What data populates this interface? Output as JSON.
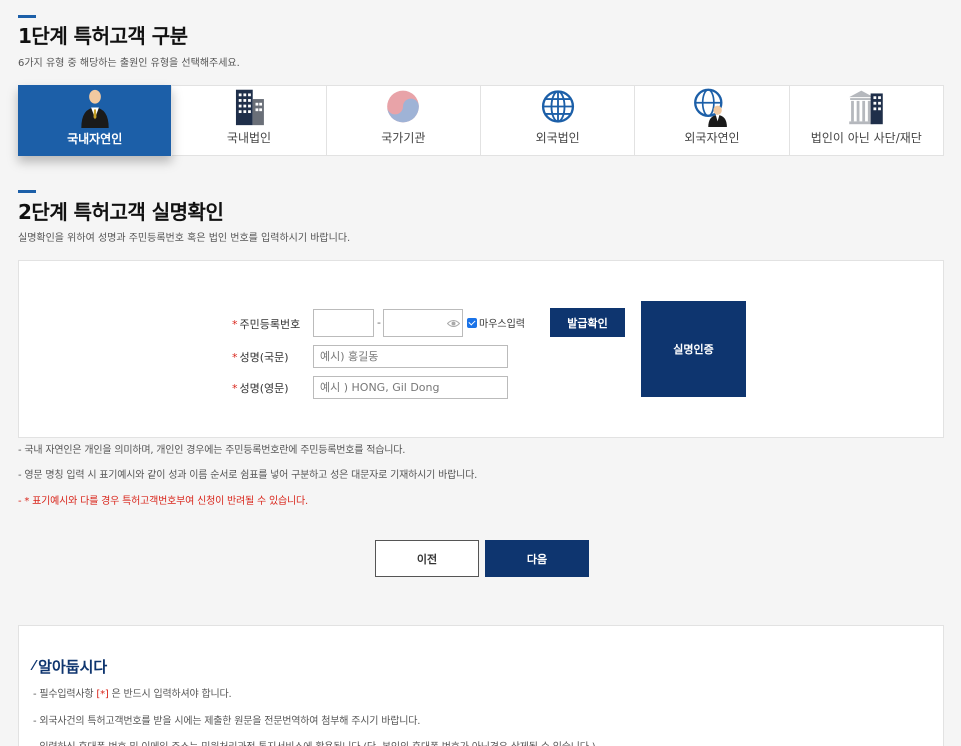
{
  "step1": {
    "title": "1단계 특허고객 구분",
    "desc": "6가지 유형 중 해당하는 출원인 유형을 선택해주세요.",
    "types": [
      {
        "label": "국내자연인",
        "icon": "person-suit-icon",
        "active": true
      },
      {
        "label": "국내법인",
        "icon": "building-icon",
        "active": false
      },
      {
        "label": "국가기관",
        "icon": "taegeuk-icon",
        "active": false
      },
      {
        "label": "외국법인",
        "icon": "globe-icon",
        "active": false
      },
      {
        "label": "외국자연인",
        "icon": "globe-person-icon",
        "active": false
      },
      {
        "label": "법인이 아닌 사단/재단",
        "icon": "institution-icon",
        "active": false
      }
    ]
  },
  "step2": {
    "title": "2단계 특허고객 실명확인",
    "desc": "실명확인을 위하여 성명과 주민등록번호 혹은 법인 번호를 입력하시기 바랍니다.",
    "required_mark": "*",
    "rrn_label": "주민등록번호",
    "rrn_dash": "-",
    "mouse_input_label": "마우스입력",
    "issue_check_label": "발급확인",
    "name_kr_label": "성명(국문)",
    "name_kr_placeholder": "예시) 홍길동",
    "name_en_label": "성명(영문)",
    "name_en_placeholder": "예시 ) HONG, Gil Dong",
    "verify_button": "실명인증"
  },
  "notes": [
    "- 국내 자연인은 개인을 의미하며, 개인인 경우에는 주민등록번호란에 주민등록번호를 적습니다.",
    "- 영문 명칭 입력 시 표기예시와 같이 성과 이름 순서로 쉼표를 넣어 구분하고 성은 대문자로 기재하시기 바랍니다.",
    "- * 표기예시와 다를 경우 특허고객번호부여 신청이 반려될 수 있습니다."
  ],
  "nav": {
    "prev": "이전",
    "next": "다음"
  },
  "notice": {
    "title": "알아둡시다",
    "line1_pre": "- 필수입력사항 ",
    "line1_mark": "[*]",
    "line1_post": " 은 반드시 입력하셔야 합니다.",
    "line2": "- 외국사건의 특허고객번호를 받을 시에는 제출한 원문을 전문번역하여 첨부해 주시기 바랍니다.",
    "line3": "- 입력하신 휴대폰 번호 및 이메일 주소는 민원처리과정 통지서비스에 활용됩니다.(단, 본인의 휴대폰 번호가 아닌경우 삭제될 수 있습니다.)"
  },
  "colors": {
    "accent": "#1c5fa8",
    "navy": "#0e356f",
    "required": "#d9261c"
  }
}
